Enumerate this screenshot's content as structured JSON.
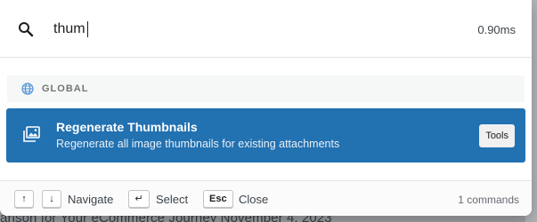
{
  "background": {
    "text": "arison for Your eCommerce Journey November 4, 2023"
  },
  "search": {
    "value": "thum",
    "placeholder": "",
    "timing": "0.90ms"
  },
  "group": {
    "label": "GLOBAL",
    "icon": "globe-icon"
  },
  "results": [
    {
      "title": "Regenerate Thumbnails",
      "description": "Regenerate all image thumbnails for existing attachments",
      "badge": "Tools",
      "icon": "images-icon",
      "selected": true
    }
  ],
  "footer": {
    "navigate_label": "Navigate",
    "select_label": "Select",
    "close_label": "Close",
    "esc_key": "Esc",
    "up_key": "↑",
    "down_key": "↓",
    "enter_key": "↵",
    "count": "1 commands"
  },
  "colors": {
    "accent": "#2271b1",
    "overlay": "#a9aaac"
  }
}
